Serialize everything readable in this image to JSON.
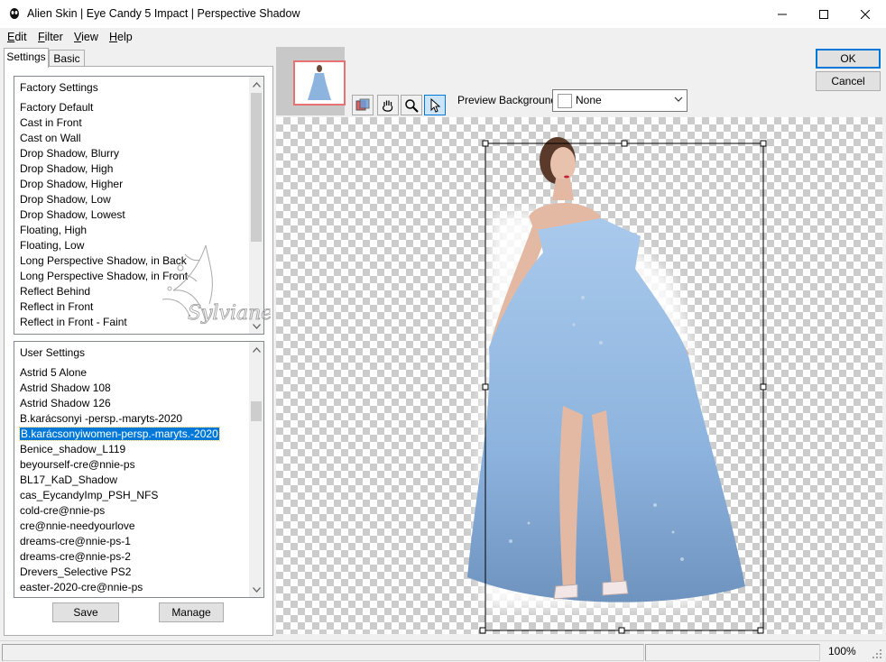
{
  "window": {
    "title": "Alien Skin | Eye Candy 5 Impact | Perspective Shadow",
    "controls": [
      "minimize-icon",
      "maximize-icon",
      "close-icon"
    ]
  },
  "menu": [
    {
      "label": "Edit",
      "mnemonic": "E",
      "rest": "dit"
    },
    {
      "label": "Filter",
      "mnemonic": "F",
      "rest": "ilter"
    },
    {
      "label": "View",
      "mnemonic": "V",
      "rest": "iew"
    },
    {
      "label": "Help",
      "mnemonic": "H",
      "rest": "elp"
    }
  ],
  "tabs": {
    "settings": "Settings",
    "basic": "Basic"
  },
  "factory": {
    "header": "Factory Settings",
    "items": [
      "Factory Default",
      "Cast in Front",
      "Cast on Wall",
      "Drop Shadow, Blurry",
      "Drop Shadow, High",
      "Drop Shadow, Higher",
      "Drop Shadow, Low",
      "Drop Shadow, Lowest",
      "Floating, High",
      "Floating, Low",
      "Long Perspective Shadow, in Back",
      "Long Perspective Shadow, in Front",
      "Reflect Behind",
      "Reflect in Front",
      "Reflect in Front - Faint"
    ]
  },
  "user": {
    "header": "User Settings",
    "selected_index": 4,
    "items": [
      "Astrid 5 Alone",
      "Astrid Shadow 108",
      "Astrid Shadow 126",
      "B.karácsonyi -persp.-maryts-2020",
      "B.karácsonyiwomen-persp.-maryts.-2020",
      "Benice_shadow_L119",
      "beyourself-cre@nnie-ps",
      "BL17_KaD_Shadow",
      "cas_EycandyImp_PSH_NFS",
      "cold-cre@nnie-ps",
      "cre@nnie-needyourlove",
      "dreams-cre@nnie-ps-1",
      "dreams-cre@nnie-ps-2",
      "Drevers_Selective PS2",
      "easter-2020-cre@nnie-ps"
    ]
  },
  "buttons": {
    "save": "Save",
    "manage": "Manage",
    "ok": "OK",
    "cancel": "Cancel"
  },
  "preview": {
    "background_label": "Preview Background:",
    "background_value": "None",
    "tools": [
      "preview-toggle-icon",
      "hand-icon",
      "zoom-icon",
      "pointer-icon"
    ],
    "active_tool": "pointer-icon",
    "watermark": "Sylviane"
  },
  "status": {
    "zoom": "100%"
  },
  "colors": {
    "selection": "#0078d7",
    "dress": "#8db4de",
    "thumb_border": "#e57373"
  }
}
